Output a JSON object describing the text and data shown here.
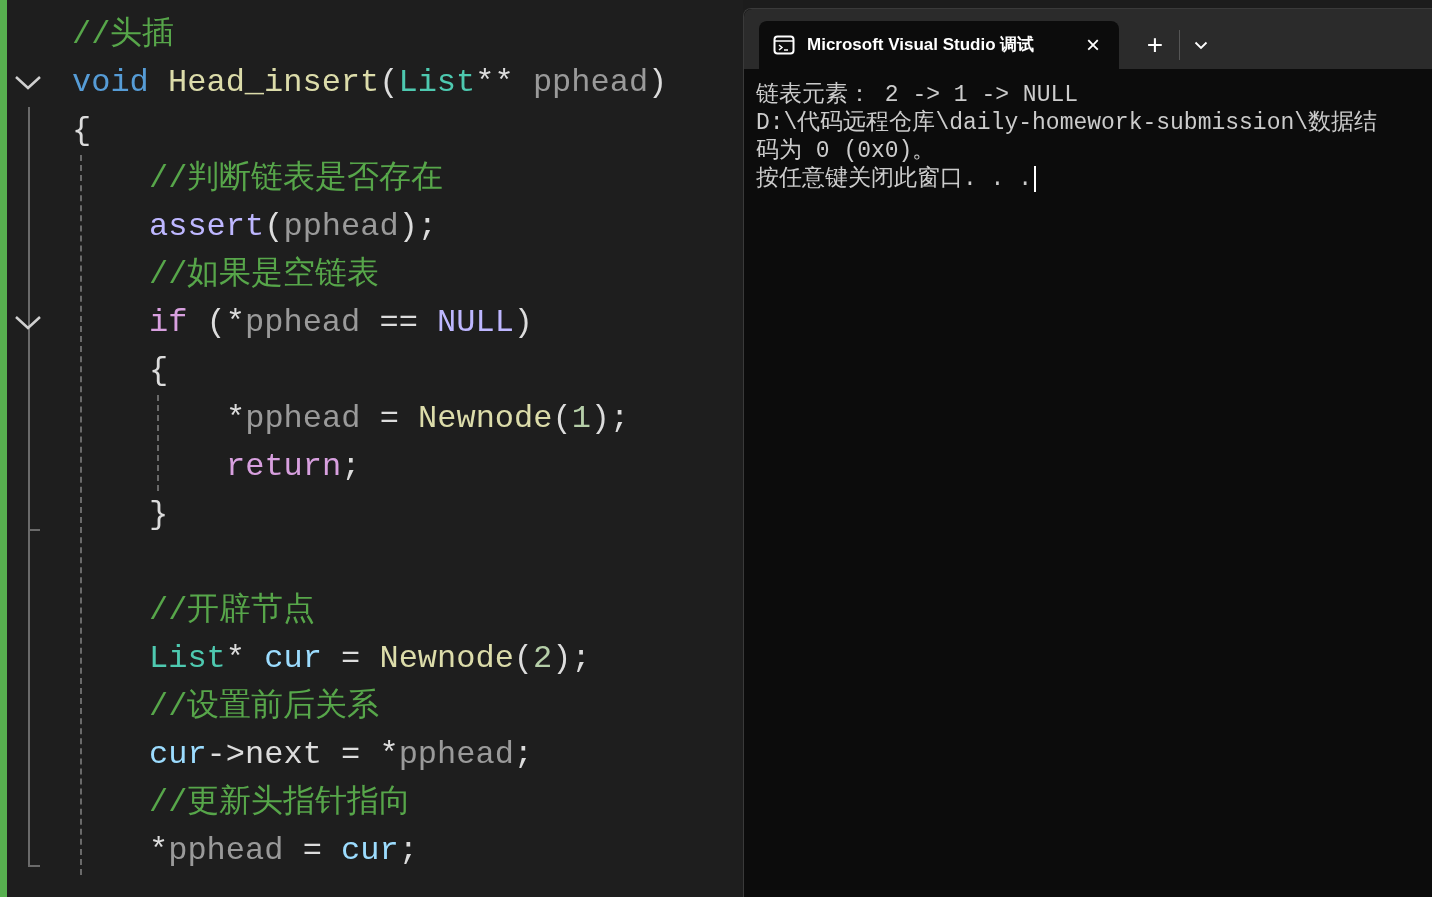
{
  "editor": {
    "lines": [
      {
        "kind": "code",
        "tokens": [
          {
            "t": "//头插",
            "kind": "comment"
          }
        ]
      },
      {
        "kind": "code",
        "expanded": true,
        "tokens": [
          {
            "t": "void ",
            "kind": "keyword"
          },
          {
            "t": "Head_insert",
            "kind": "func"
          },
          {
            "t": "(",
            "kind": "plain"
          },
          {
            "t": "List",
            "kind": "type"
          },
          {
            "t": "** ",
            "kind": "plain"
          },
          {
            "t": "pphead",
            "kind": "param"
          },
          {
            "t": ")",
            "kind": "plain"
          }
        ],
        "region": [
          {
            "kind": "code",
            "tokens": [
              {
                "t": "{",
                "kind": "plain"
              }
            ],
            "children": [
              {
                "kind": "code",
                "tokens": [
                  {
                    "t": "//判断链表是否存在",
                    "kind": "comment"
                  }
                ]
              },
              {
                "kind": "code",
                "tokens": [
                  {
                    "t": "assert",
                    "kind": "macro"
                  },
                  {
                    "t": "(",
                    "kind": "plain"
                  },
                  {
                    "t": "pphead",
                    "kind": "param"
                  },
                  {
                    "t": ");",
                    "kind": "plain"
                  }
                ]
              },
              {
                "kind": "code",
                "tokens": [
                  {
                    "t": "//如果是空链表",
                    "kind": "comment"
                  }
                ]
              },
              {
                "kind": "code",
                "expanded": true,
                "tokens": [
                  {
                    "t": "if",
                    "kind": "control"
                  },
                  {
                    "t": " (*",
                    "kind": "plain"
                  },
                  {
                    "t": "pphead",
                    "kind": "param"
                  },
                  {
                    "t": " == ",
                    "kind": "plain"
                  },
                  {
                    "t": "NULL",
                    "kind": "macro"
                  },
                  {
                    "t": ")",
                    "kind": "plain"
                  }
                ],
                "region": [
                  {
                    "kind": "code",
                    "tokens": [
                      {
                        "t": "{",
                        "kind": "plain"
                      }
                    ],
                    "children": [
                      {
                        "kind": "code",
                        "tokens": [
                          {
                            "t": "*",
                            "kind": "plain"
                          },
                          {
                            "t": "pphead",
                            "kind": "param"
                          },
                          {
                            "t": " = ",
                            "kind": "plain"
                          },
                          {
                            "t": "Newnode",
                            "kind": "func"
                          },
                          {
                            "t": "(",
                            "kind": "plain"
                          },
                          {
                            "t": "1",
                            "kind": "number"
                          },
                          {
                            "t": ");",
                            "kind": "plain"
                          }
                        ]
                      },
                      {
                        "kind": "code",
                        "tokens": [
                          {
                            "t": "return",
                            "kind": "control"
                          },
                          {
                            "t": ";",
                            "kind": "plain"
                          }
                        ]
                      }
                    ]
                  },
                  {
                    "kind": "code",
                    "tokens": [
                      {
                        "t": "}",
                        "kind": "plain"
                      }
                    ]
                  }
                ]
              },
              {
                "kind": "blank"
              },
              {
                "kind": "code",
                "tokens": [
                  {
                    "t": "//开辟节点",
                    "kind": "comment"
                  }
                ]
              },
              {
                "kind": "code",
                "tokens": [
                  {
                    "t": "List",
                    "kind": "type"
                  },
                  {
                    "t": "* ",
                    "kind": "plain"
                  },
                  {
                    "t": "cur",
                    "kind": "local"
                  },
                  {
                    "t": " = ",
                    "kind": "plain"
                  },
                  {
                    "t": "Newnode",
                    "kind": "func"
                  },
                  {
                    "t": "(",
                    "kind": "plain"
                  },
                  {
                    "t": "2",
                    "kind": "number"
                  },
                  {
                    "t": ");",
                    "kind": "plain"
                  }
                ]
              },
              {
                "kind": "code",
                "tokens": [
                  {
                    "t": "//设置前后关系",
                    "kind": "comment"
                  }
                ]
              },
              {
                "kind": "code",
                "tokens": [
                  {
                    "t": "cur",
                    "kind": "local"
                  },
                  {
                    "t": "->next = *",
                    "kind": "plain"
                  },
                  {
                    "t": "pphead",
                    "kind": "param"
                  },
                  {
                    "t": ";",
                    "kind": "plain"
                  }
                ]
              },
              {
                "kind": "code",
                "tokens": [
                  {
                    "t": "//更新头指针指向",
                    "kind": "comment"
                  }
                ]
              },
              {
                "kind": "code",
                "tokens": [
                  {
                    "t": "*",
                    "kind": "plain"
                  },
                  {
                    "t": "pphead",
                    "kind": "param"
                  },
                  {
                    "t": " = ",
                    "kind": "plain"
                  },
                  {
                    "t": "cur",
                    "kind": "local"
                  },
                  {
                    "t": ";",
                    "kind": "plain"
                  }
                ]
              }
            ]
          }
        ]
      }
    ]
  },
  "terminal": {
    "tab": {
      "title": "Microsoft Visual Studio 调试",
      "selected": true,
      "close": "×"
    },
    "new_tab": "+",
    "lines": [
      {
        "text": "链表元素： 2 -> 1 -> NULL",
        "cursor": false
      },
      {
        "text": "D:\\代码远程仓库\\daily-homework-submission\\数据结",
        "cursor": false
      },
      {
        "text": "码为 0 (0x0)。",
        "cursor": false
      },
      {
        "text": "按任意键关闭此窗口. . .",
        "cursor": true
      }
    ]
  }
}
